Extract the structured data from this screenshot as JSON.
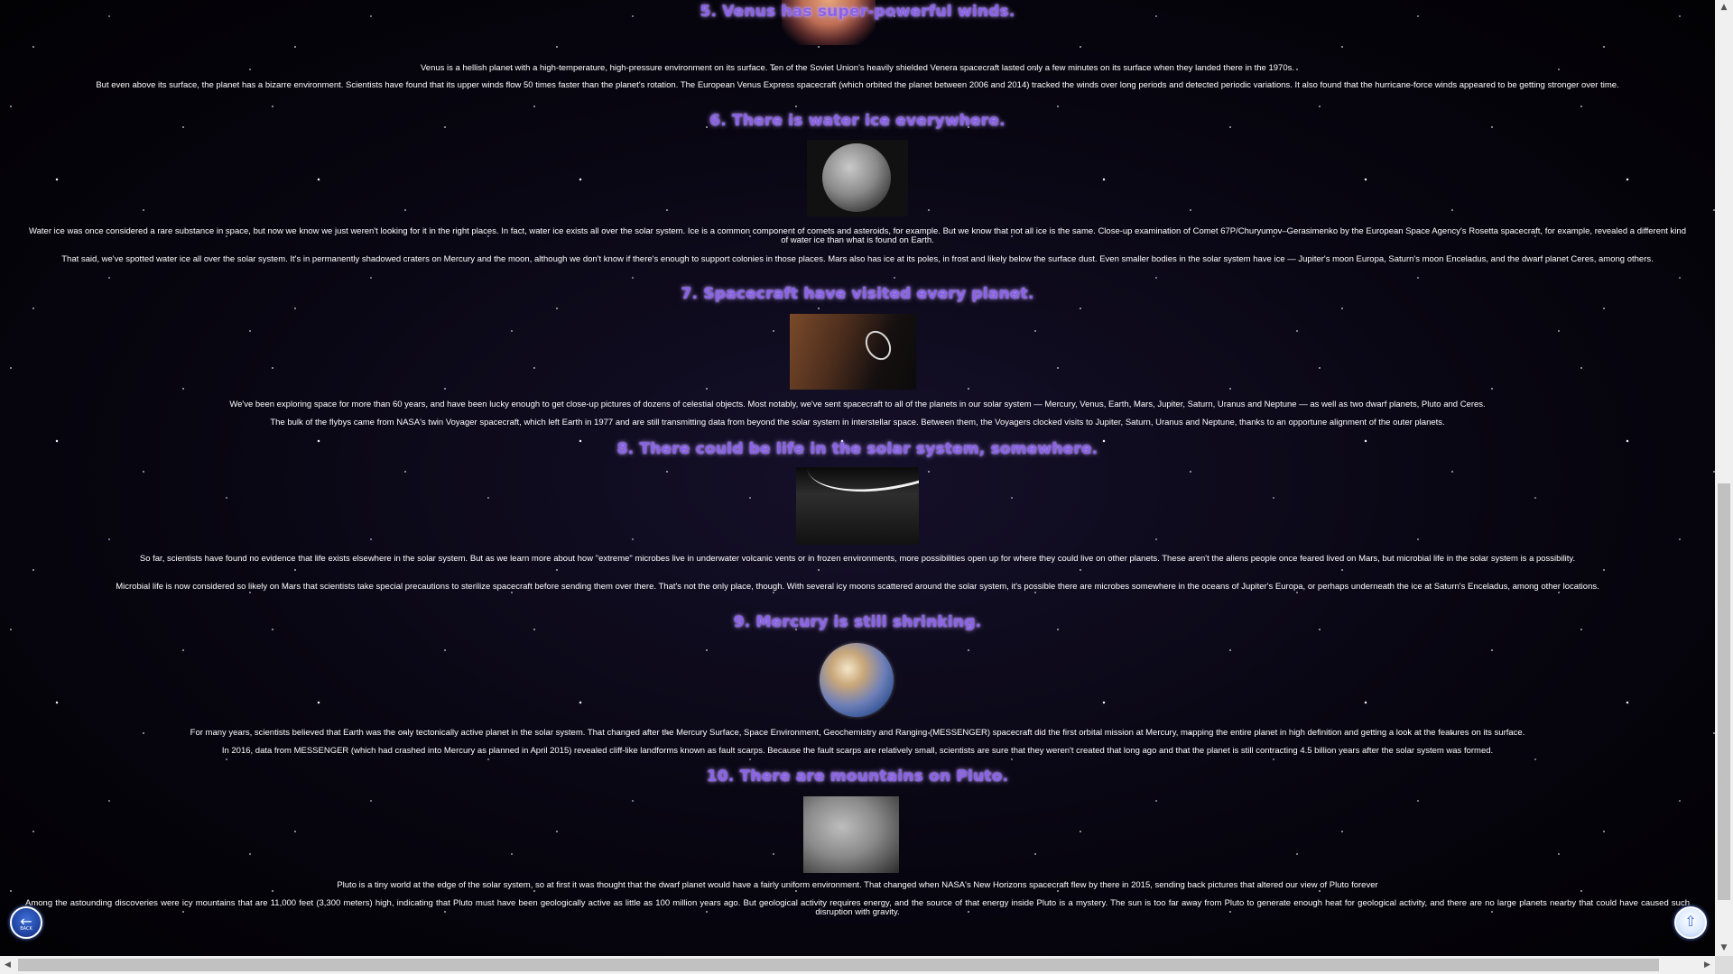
{
  "sections": [
    {
      "heading": "5. Venus has super-powerful winds.",
      "paragraphs": [
        "Venus is a hellish planet with a high-temperature, high-pressure environment on its surface. Ten of the Soviet Union's heavily shielded Venera spacecraft lasted only a few minutes on its surface when they landed there in the 1970s.",
        "But even above its surface, the planet has a bizarre environment. Scientists have found that its upper winds flow 50 times faster than the planet's rotation. The European Venus Express spacecraft (which orbited the planet between 2006 and 2014) tracked the winds over long periods and detected periodic variations. It also found that the hurricane-force winds appeared to be getting stronger over time."
      ]
    },
    {
      "heading": "6. There is water ice everywhere.",
      "paragraphs": [
        "Water ice was once considered a rare substance in space, but now we know we just weren't looking for it in the right places. In fact, water ice exists all over the solar system. Ice is a common component of comets and asteroids, for example. But we know that not all ice is the same. Close-up examination of Comet 67P/Churyumov–Gerasimenko by the European Space Agency's Rosetta spacecraft, for example, revealed a different kind of water ice than what is found on Earth.",
        "That said, we've spotted water ice all over the solar system. It's in permanently shadowed craters on Mercury and the moon, although we don't know if there's enough to support colonies in those places. Mars also has ice at its poles, in frost and likely below the surface dust. Even smaller bodies in the solar system have ice — Jupiter's moon Europa, Saturn's moon Enceladus, and the dwarf planet Ceres, among others."
      ]
    },
    {
      "heading": "7. Spacecraft have visited every planet.",
      "paragraphs": [
        "We've been exploring space for more than 60 years, and have been lucky enough to get close-up pictures of dozens of celestial objects. Most notably, we've sent spacecraft to all of the planets in our solar system — Mercury, Venus, Earth, Mars, Jupiter, Saturn, Uranus and Neptune — as well as two dwarf planets, Pluto and Ceres.",
        "The bulk of the flybys came from NASA's twin Voyager spacecraft, which left Earth in 1977 and are still transmitting data from beyond the solar system in interstellar space. Between them, the Voyagers clocked visits to Jupiter, Saturn, Uranus and Neptune, thanks to an opportune alignment of the outer planets."
      ]
    },
    {
      "heading": "8. There could be life in the solar system, somewhere.",
      "paragraphs": [
        "So far, scientists have found no evidence that life exists elsewhere in the solar system. But as we learn more about how \"extreme\" microbes live in underwater volcanic vents or in frozen environments, more possibilities open up for where they could live on other planets. These aren't the aliens people once feared lived on Mars, but microbial life in the solar system is a possibility.",
        "Microbial life is now considered so likely on Mars that scientists take special precautions to sterilize spacecraft before sending them over there. That's not the only place, though. With several icy moons scattered around the solar system, it's possible there are microbes somewhere in the oceans of Jupiter's Europa, or perhaps underneath the ice at Saturn's Enceladus, among other locations."
      ]
    },
    {
      "heading": "9. Mercury is still shrinking.",
      "paragraphs": [
        "For many years, scientists believed that Earth was the only tectonically active planet in the solar system. That changed after the Mercury Surface, Space Environment, Geochemistry and Ranging (MESSENGER) spacecraft did the first orbital mission at Mercury, mapping the entire planet in high definition and getting a look at the features on its surface.",
        "In 2016, data from MESSENGER (which had crashed into Mercury as planned in April 2015) revealed cliff-like landforms known as fault scarps. Because the fault scarps are relatively small, scientists are sure that they weren't created that long ago and that the planet is still contracting 4.5 billion years after the solar system was formed."
      ]
    },
    {
      "heading": "10. There are mountains on Pluto.",
      "paragraphs": [
        "Pluto is a tiny world at the edge of the solar system, so at first it was thought that the dwarf planet would have a fairly uniform environment. That changed when NASA's New Horizons spacecraft flew by there in 2015, sending back pictures that altered our view of Pluto forever",
        "Among the astounding discoveries were icy mountains that are 11,000 feet (3,300 meters) high, indicating that Pluto must have been geologically active as little as 100 million years ago. But geological activity requires energy, and the source of that energy inside Pluto is a mystery. The sun is too far away from Pluto to generate enough heat for geological activity, and there are no large planets nearby that could have caused such disruption with gravity."
      ]
    }
  ],
  "buttons": {
    "back_icon": "arrow-left-icon",
    "back_label": "BACK",
    "top_icon": "arrow-up-icon"
  },
  "colors": {
    "heading": "#8a63e6",
    "heading_glow": "#b08cff",
    "text": "#ffffff",
    "background": "#07050f"
  }
}
